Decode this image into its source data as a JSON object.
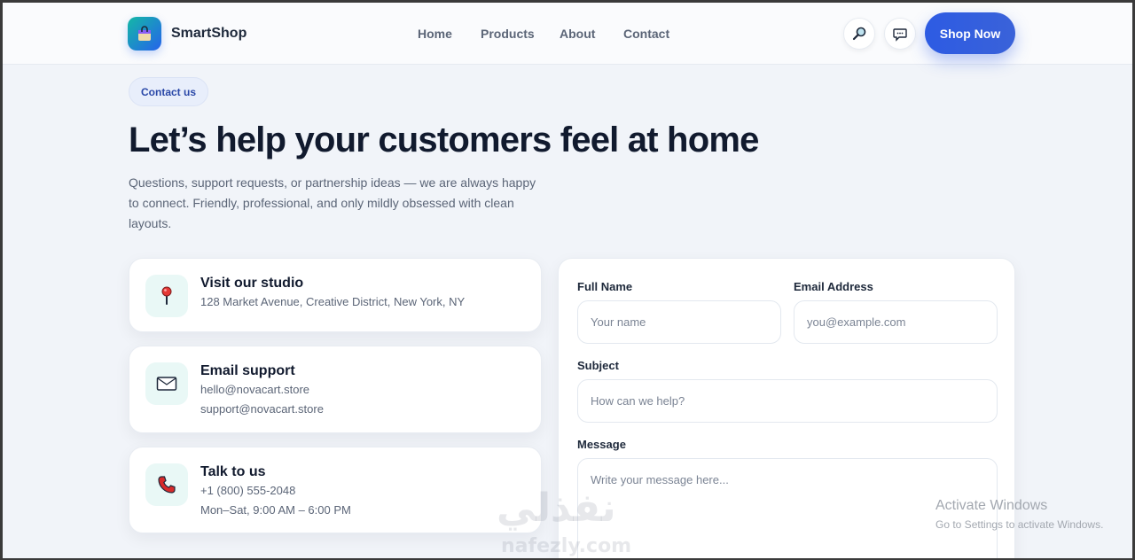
{
  "header": {
    "brand": "SmartShop",
    "nav": [
      {
        "label": "Home"
      },
      {
        "label": "Products"
      },
      {
        "label": "About"
      },
      {
        "label": "Contact"
      }
    ],
    "cta_label": "Shop Now",
    "icons": [
      "search-icon",
      "chat-icon",
      "shopping-bag-icon"
    ]
  },
  "hero": {
    "pill": "Contact us",
    "title": "Let’s help your customers feel at home",
    "subtitle": "Questions, support requests, or partnership ideas — we are always happy to connect. Friendly, professional, and only mildly obsessed with clean layouts."
  },
  "info_cards": [
    {
      "icon": "pin-icon",
      "title": "Visit our studio",
      "lines": [
        "128 Market Avenue, Creative District, New York, NY"
      ]
    },
    {
      "icon": "envelope-icon",
      "title": "Email support",
      "lines": [
        "hello@novacart.store",
        "support@novacart.store"
      ]
    },
    {
      "icon": "phone-icon",
      "title": "Talk to us",
      "lines": [
        "+1 (800) 555-2048",
        "Mon–Sat, 9:00 AM – 6:00 PM"
      ]
    }
  ],
  "form": {
    "full_name": {
      "label": "Full Name",
      "placeholder": "Your name",
      "value": ""
    },
    "email": {
      "label": "Email Address",
      "placeholder": "you@example.com",
      "value": ""
    },
    "subject": {
      "label": "Subject",
      "placeholder": "How can we help?",
      "value": ""
    },
    "message": {
      "label": "Message",
      "placeholder": "Write your message here...",
      "value": ""
    }
  },
  "overlays": {
    "watermark_arabic": "نفذلي",
    "watermark_latin": "nafezly.com",
    "windows_activation_title": "Activate Windows",
    "windows_activation_sub": "Go to Settings to activate Windows."
  },
  "colors": {
    "accent": "#2d5be3",
    "logo_gradient": [
      "#14b8a6",
      "#2563eb"
    ],
    "page_bg": "#f1f4f9"
  }
}
